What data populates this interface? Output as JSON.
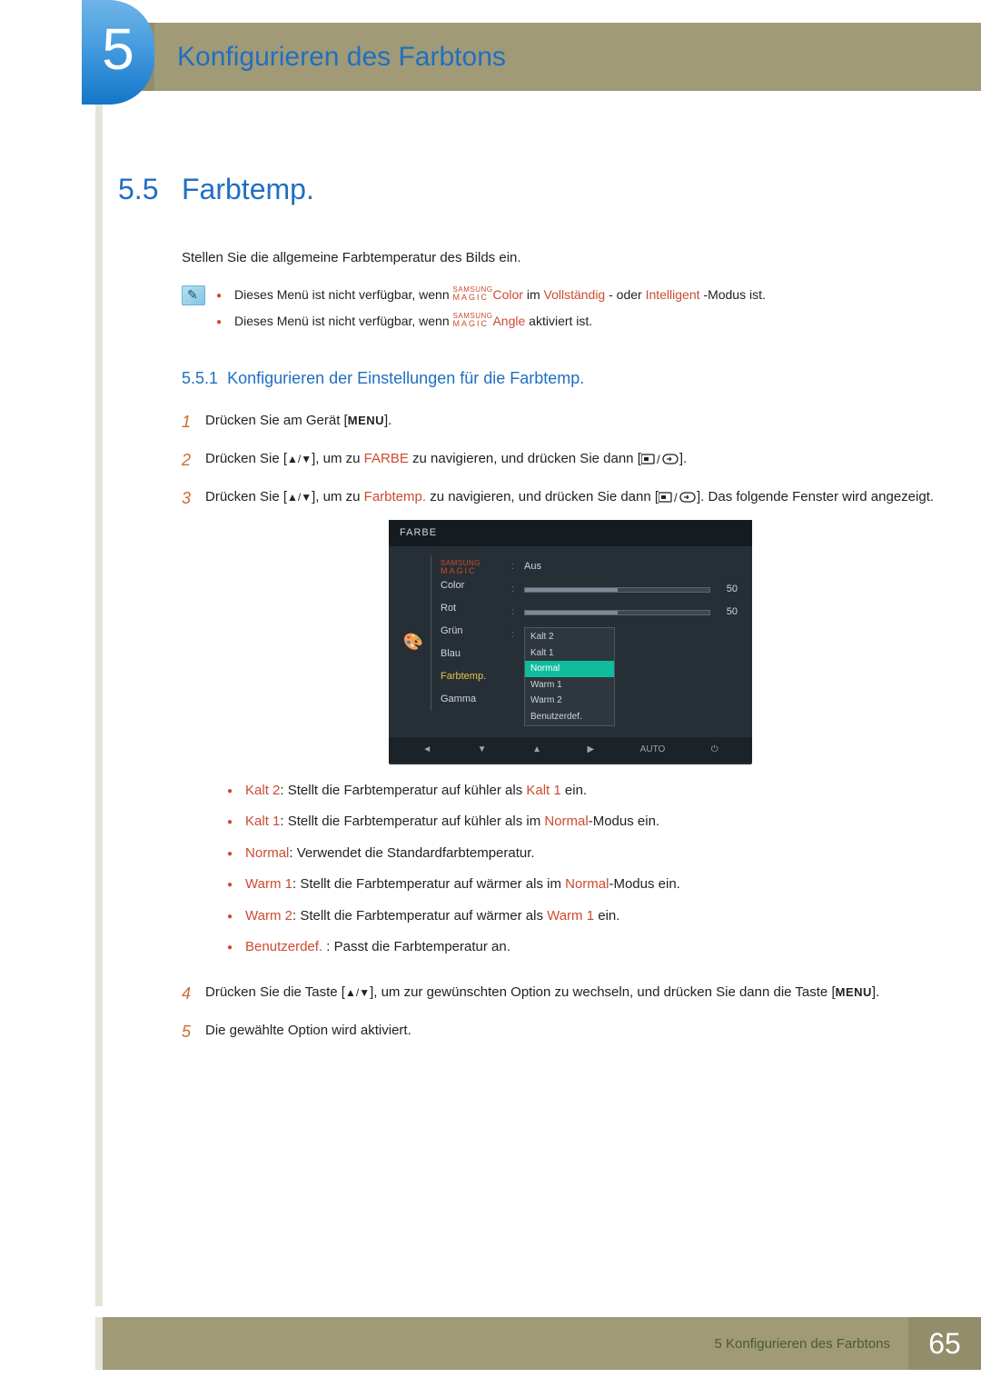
{
  "chapter_number": "5",
  "chapter_title": "Konfigurieren des Farbtons",
  "section_number": "5.5",
  "section_title": "Farbtemp.",
  "intro": "Stellen Sie die allgemeine Farbtemperatur des Bilds ein.",
  "note_items": [
    {
      "prefix": "Dieses Menü ist nicht verfügbar, wenn ",
      "magic": true,
      "magic_suffix": "Color",
      "mid": " im ",
      "orange1": "Vollständig",
      "mid2": " - oder ",
      "orange2": "Intelligent",
      "suffix": " -Modus ist."
    },
    {
      "prefix": "Dieses Menü ist nicht verfügbar, wenn ",
      "magic": true,
      "magic_suffix": "Angle",
      "suffix": " aktiviert ist."
    }
  ],
  "subsection_number": "5.5.1",
  "subsection_title": "Konfigurieren der Einstellungen für die Farbtemp.",
  "steps": {
    "s1": {
      "num": "1",
      "pre": "Drücken Sie am Gerät [",
      "btn": "MENU",
      "post": "]."
    },
    "s2": {
      "num": "2",
      "pre": "Drücken Sie [",
      "arrows": "▲/▼",
      "mid1": "], um zu ",
      "target": "FARBE",
      "mid2": " zu navigieren, und drücken Sie dann [",
      "post": "]."
    },
    "s3": {
      "num": "3",
      "pre": "Drücken Sie [",
      "arrows": "▲/▼",
      "mid1": "], um zu ",
      "target": "Farbtemp.",
      "mid2": " zu navigieren, und drücken Sie dann [",
      "post": "]. Das folgende Fenster wird angezeigt."
    },
    "s4": {
      "num": "4",
      "pre": "Drücken Sie die Taste [",
      "arrows": "▲/▼",
      "mid": "], um zur gewünschten Option zu wechseln, und drücken Sie dann die Taste [",
      "btn": "MENU",
      "post": "]."
    },
    "s5": {
      "num": "5",
      "text": "Die gewählte Option wird aktiviert."
    }
  },
  "osd": {
    "header": "FARBE",
    "labels": {
      "magic_color": "Color",
      "rot": "Rot",
      "grn": "Grün",
      "blau": "Blau",
      "farbtemp": "Farbtemp.",
      "gamma": "Gamma"
    },
    "values": {
      "magic_color": "Aus",
      "rot": "50",
      "grn": "50",
      "dropdown": [
        "Kalt 2",
        "Kalt 1",
        "Normal",
        "Warm 1",
        "Warm 2",
        "Benutzerdef."
      ],
      "selected": "Normal"
    },
    "footer": {
      "auto": "AUTO"
    }
  },
  "options": [
    {
      "label": "Kalt 2",
      "text": ": Stellt die Farbtemperatur auf kühler als ",
      "ref": "Kalt 1",
      "suffix": " ein."
    },
    {
      "label": "Kalt 1",
      "text": ": Stellt die Farbtemperatur auf kühler als im ",
      "ref": "Normal",
      "suffix": "-Modus ein."
    },
    {
      "label": "Normal",
      "text": ": Verwendet die Standardfarbtemperatur.",
      "ref": "",
      "suffix": ""
    },
    {
      "label": "Warm 1",
      "text": ": Stellt die Farbtemperatur auf wärmer als im ",
      "ref": "Normal",
      "suffix": "-Modus ein."
    },
    {
      "label": "Warm 2",
      "text": ": Stellt die Farbtemperatur auf wärmer als ",
      "ref": "Warm 1",
      "suffix": " ein."
    },
    {
      "label": "Benutzerdef.",
      "text": " : Passt die Farbtemperatur an.",
      "ref": "",
      "suffix": ""
    }
  ],
  "footer": {
    "text": "5 Konfigurieren des Farbtons",
    "page": "65"
  }
}
